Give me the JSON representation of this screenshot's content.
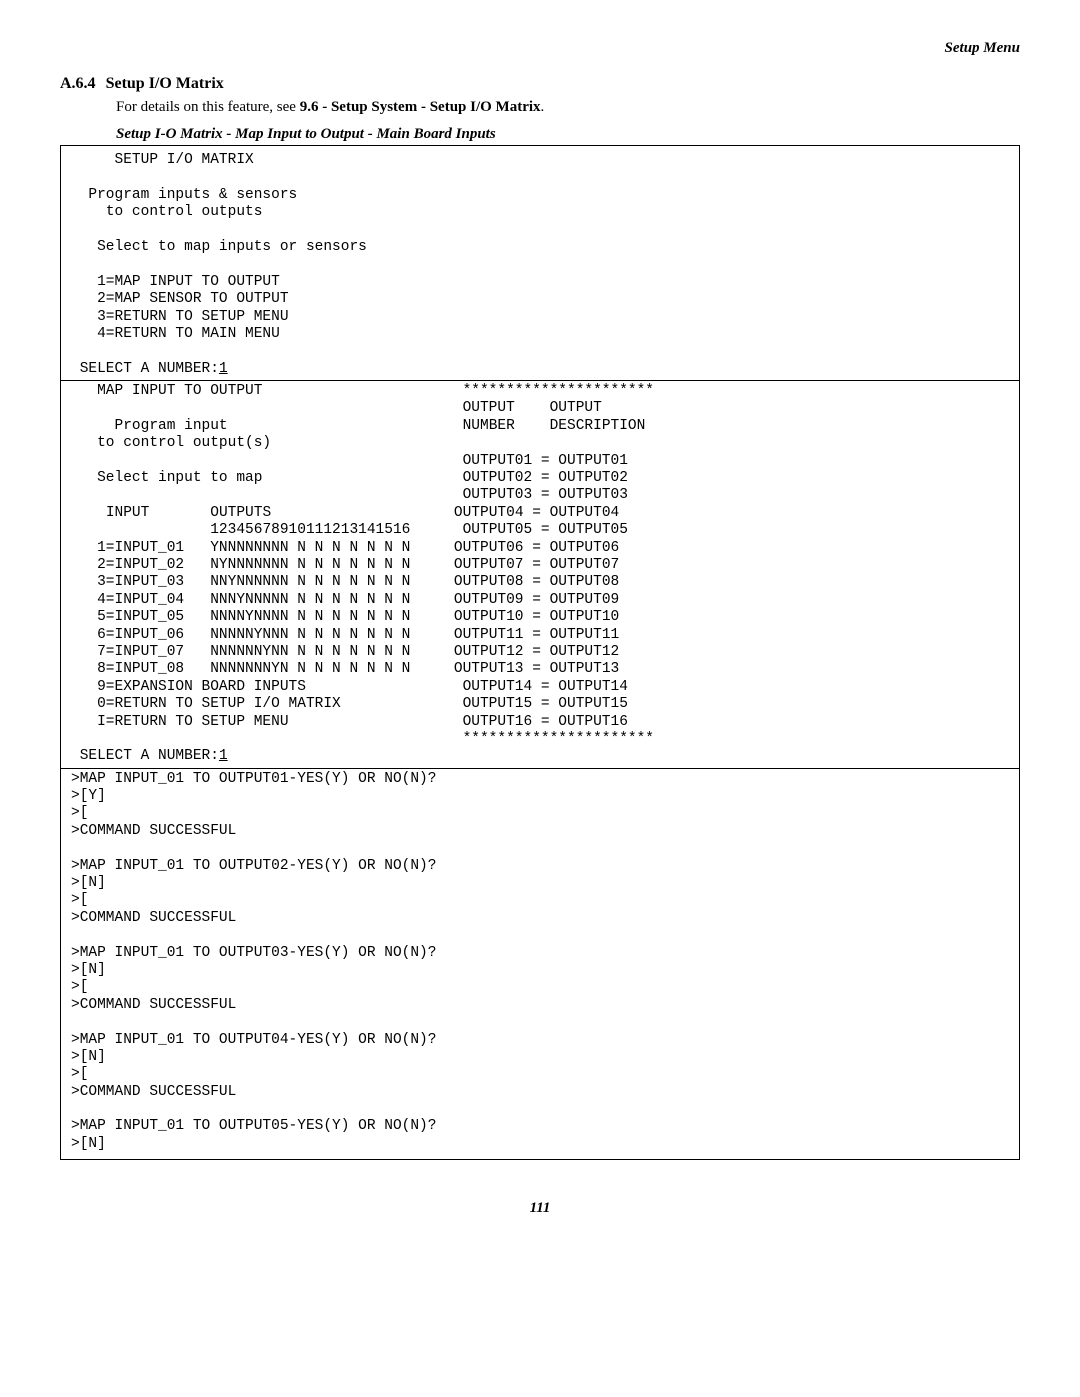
{
  "header": {
    "right": "Setup Menu"
  },
  "section": {
    "number": "A.6.4",
    "title": "Setup I/O Matrix",
    "detail_prefix": "For details on this feature, see ",
    "detail_bold": "9.6 - Setup System - Setup I/O Matrix",
    "detail_suffix": "."
  },
  "caption": "Setup I-O Matrix - Map Input to Output - Main Board Inputs",
  "screen1": {
    "title": "SETUP I/O MATRIX",
    "line1": "Program inputs & sensors",
    "line2": "to control outputs",
    "line3": "Select to map inputs or sensors",
    "opt1": "1=MAP INPUT TO OUTPUT",
    "opt2": "2=MAP SENSOR TO OUTPUT",
    "opt3": "3=RETURN TO SETUP MENU",
    "opt4": "4=RETURN TO MAIN MENU",
    "prompt": "SELECT A NUMBER:",
    "input": "1"
  },
  "screen2": {
    "left": {
      "title": "MAP INPUT TO OUTPUT",
      "l1": "Program input",
      "l2": "to control output(s)",
      "l3": "Select input to map",
      "hdr1": "INPUT",
      "hdr2": "OUTPUTS",
      "hdr3": "12345678910111213141516",
      "r1": "1=INPUT_01   YNNNNNNNN N N N N N N N",
      "r2": "2=INPUT_02   NYNNNNNNN N N N N N N N",
      "r3": "3=INPUT_03   NNYNNNNNN N N N N N N N",
      "r4": "4=INPUT_04   NNNYNNNNN N N N N N N N",
      "r5": "5=INPUT_05   NNNNYNNNN N N N N N N N",
      "r6": "6=INPUT_06   NNNNNYNNN N N N N N N N",
      "r7": "7=INPUT_07   NNNNNNYNN N N N N N N N",
      "r8": "8=INPUT_08   NNNNNNNYN N N N N N N N",
      "r9": "9=EXPANSION BOARD INPUTS",
      "r10": "0=RETURN TO SETUP I/O MATRIX",
      "r11": "I=RETURN TO SETUP MENU"
    },
    "right": {
      "stars": "**********************",
      "h1": "OUTPUT    OUTPUT",
      "h2": "NUMBER    DESCRIPTION",
      "o1": "OUTPUT01 = OUTPUT01",
      "o2": "OUTPUT02 = OUTPUT02",
      "o3": "OUTPUT03 = OUTPUT03",
      "o4": "OUTPUT04 = OUTPUT04",
      "o5": "OUTPUT05 = OUTPUT05",
      "o6": "OUTPUT06 = OUTPUT06",
      "o7": "OUTPUT07 = OUTPUT07",
      "o8": "OUTPUT08 = OUTPUT08",
      "o9": "OUTPUT09 = OUTPUT09",
      "o10": "OUTPUT10 = OUTPUT10",
      "o11": "OUTPUT11 = OUTPUT11",
      "o12": "OUTPUT12 = OUTPUT12",
      "o13": "OUTPUT13 = OUTPUT13",
      "o14": "OUTPUT14 = OUTPUT14",
      "o15": "OUTPUT15 = OUTPUT15",
      "o16": "OUTPUT16 = OUTPUT16"
    },
    "prompt": "SELECT A NUMBER:",
    "input": "1"
  },
  "screen3": {
    "p1": ">MAP INPUT_01 TO OUTPUT01-YES(Y) OR NO(N)?",
    "a1": ">[Y]",
    "b1": ">[",
    "c1": ">COMMAND SUCCESSFUL",
    "p2": ">MAP INPUT_01 TO OUTPUT02-YES(Y) OR NO(N)?",
    "a2": ">[N]",
    "b2": ">[",
    "c2": ">COMMAND SUCCESSFUL",
    "p3": ">MAP INPUT_01 TO OUTPUT03-YES(Y) OR NO(N)?",
    "a3": ">[N]",
    "b3": ">[",
    "c3": ">COMMAND SUCCESSFUL",
    "p4": ">MAP INPUT_01 TO OUTPUT04-YES(Y) OR NO(N)?",
    "a4": ">[N]",
    "b4": ">[",
    "c4": ">COMMAND SUCCESSFUL",
    "p5": ">MAP INPUT_01 TO OUTPUT05-YES(Y) OR NO(N)?",
    "a5": ">[N]"
  },
  "page": "111"
}
